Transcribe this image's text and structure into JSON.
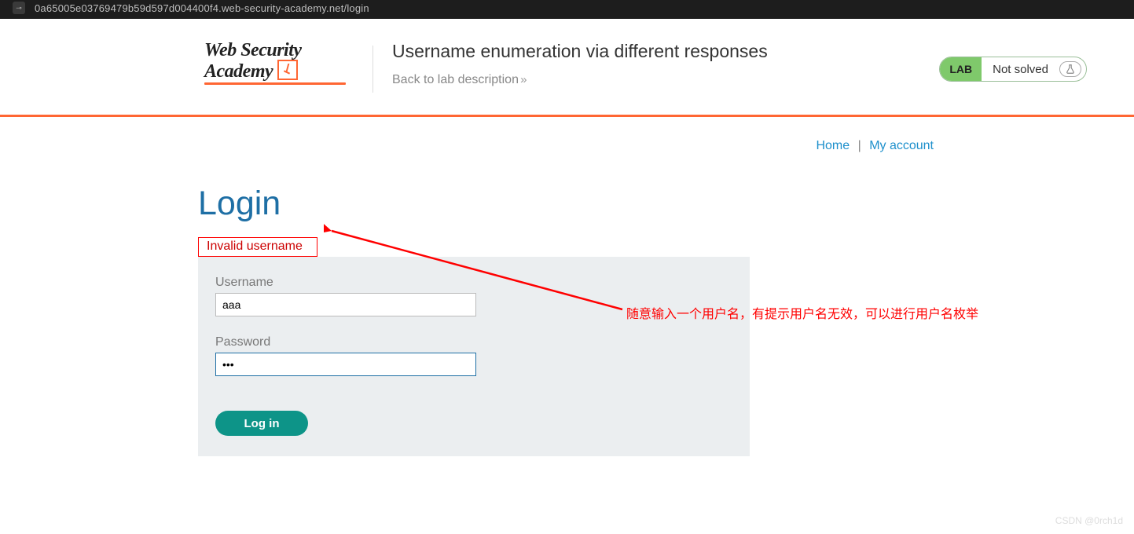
{
  "address_bar": {
    "url": "0a65005e03769479b59d597d004400f4.web-security-academy.net/login"
  },
  "logo": {
    "line1": "Web Security",
    "line2": "Academy"
  },
  "header": {
    "title": "Username enumeration via different responses",
    "back_link": "Back to lab description"
  },
  "status": {
    "lab_tag": "LAB",
    "text": "Not solved"
  },
  "nav": {
    "home": "Home",
    "sep": "|",
    "account": "My account"
  },
  "login": {
    "heading": "Login",
    "error": "Invalid username",
    "username_label": "Username",
    "username_value": "aaa",
    "password_label": "Password",
    "password_value": "•••",
    "button": "Log in"
  },
  "annotation": {
    "text": "随意输入一个用户名，有提示用户名无效，可以进行用户名枚举"
  },
  "watermark": "CSDN @0rch1d"
}
